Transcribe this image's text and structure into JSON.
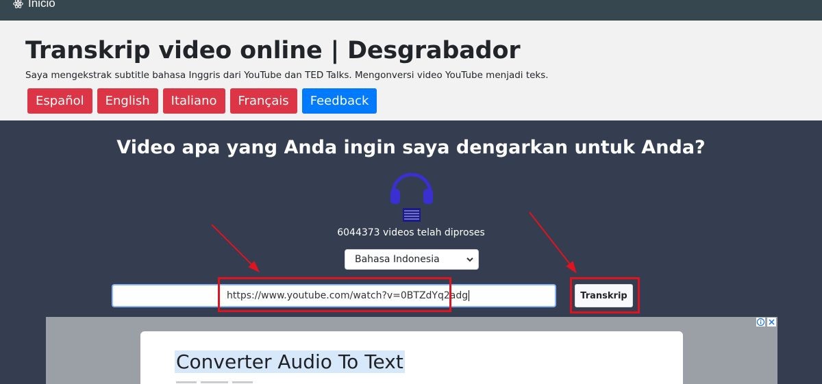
{
  "nav": {
    "brand": "Inicio",
    "brand_icon": "atom-icon"
  },
  "header": {
    "title": "Transkrip video online | Desgrabador",
    "subtitle": "Saya mengekstrak subtitle bahasa Inggris dari YouTube dan TED Talks. Mengonversi video YouTube menjadi teks.",
    "languages": [
      "Español",
      "English",
      "Italiano",
      "Français"
    ],
    "feedback": "Feedback"
  },
  "main": {
    "question": "Video apa yang Anda ingin saya dengarkan untuk Anda?",
    "headphones_icon": "headphones-icon",
    "processed": "6044373 videos telah diproses",
    "language_select": {
      "selected": "Bahasa Indonesia"
    },
    "url_input": {
      "value": "https://www.youtube.com/watch?v=0BTZdYq2adg"
    },
    "submit": "Transkrip"
  },
  "ad": {
    "title": "Converter Audio To Text"
  },
  "colors": {
    "lang_button": "#dc3545",
    "feedback_button": "#007bff",
    "highlight": "#e0141e",
    "main_bg": "#343e50",
    "nav_bg": "#37474f",
    "headphones": "#3a2fd0"
  }
}
